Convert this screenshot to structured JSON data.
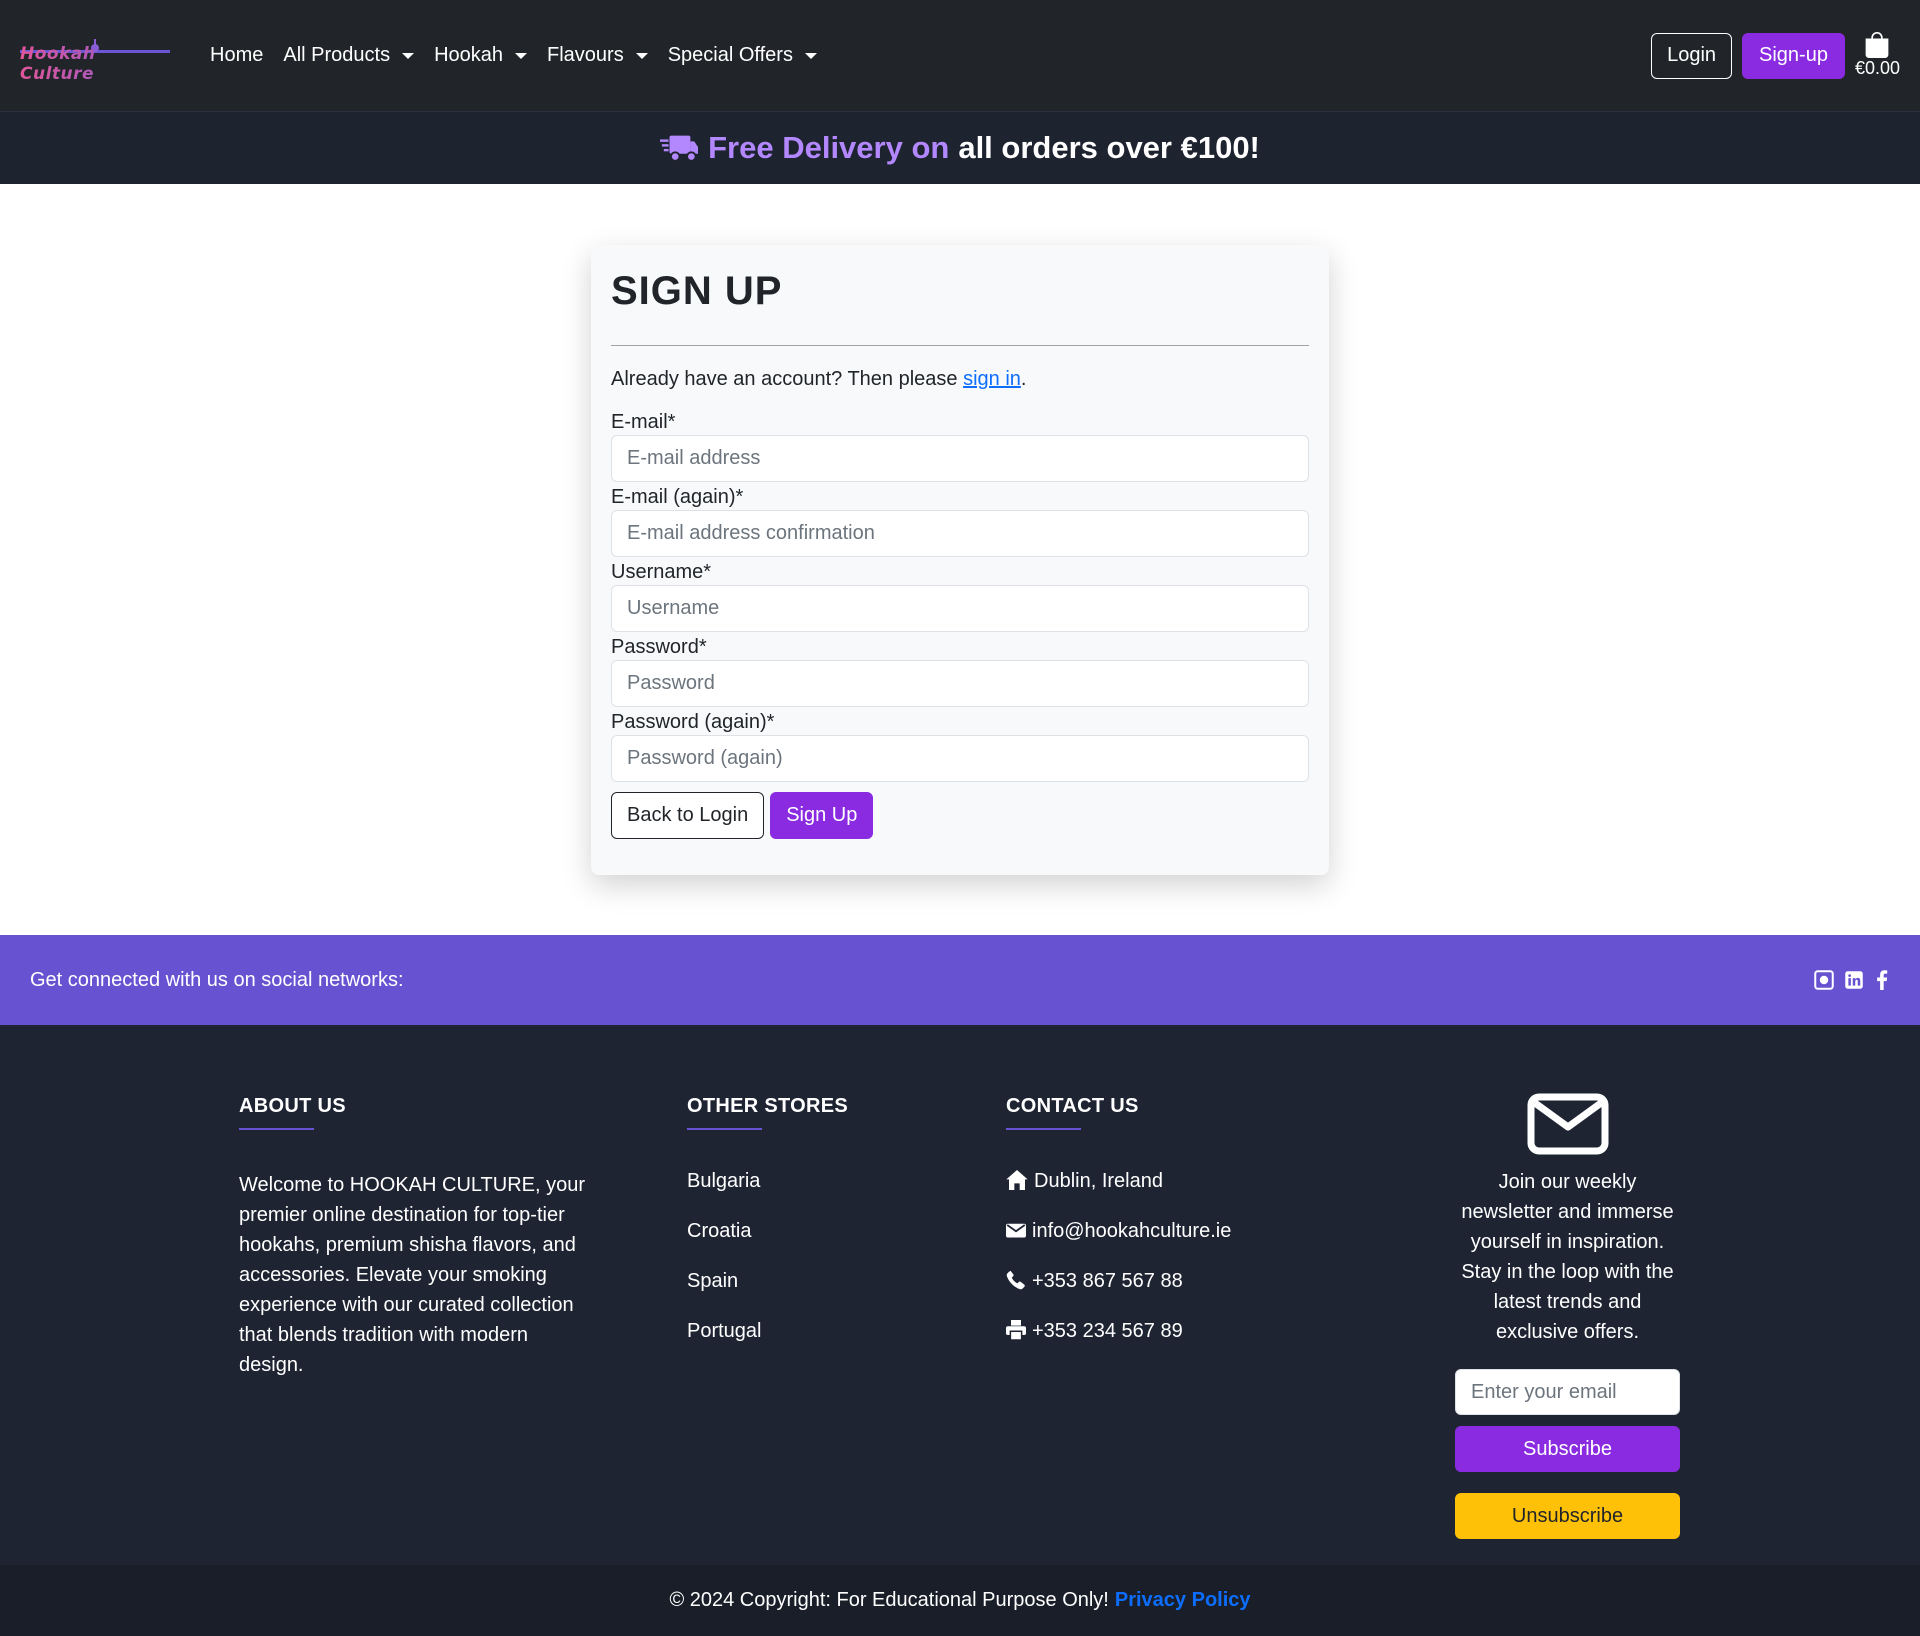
{
  "nav": {
    "logo_text": "Hookah Culture",
    "links": [
      {
        "label": "Home",
        "dropdown": false
      },
      {
        "label": "All Products",
        "dropdown": true
      },
      {
        "label": "Hookah",
        "dropdown": true
      },
      {
        "label": "Flavours",
        "dropdown": true
      },
      {
        "label": "Special Offers",
        "dropdown": true
      }
    ],
    "login_label": "Login",
    "signup_label": "Sign-up",
    "cart_total": "€0.00"
  },
  "banner": {
    "accent_text": "Free Delivery on",
    "rest_text": "all orders over €100!",
    "icon": "truck-icon"
  },
  "signup": {
    "title": "SIGN UP",
    "intro_prefix": "Already have an account? Then please",
    "intro_link": "sign in",
    "intro_suffix": ".",
    "fields": [
      {
        "label": "E-mail*",
        "placeholder": "E-mail address"
      },
      {
        "label": "E-mail (again)*",
        "placeholder": "E-mail address confirmation"
      },
      {
        "label": "Username*",
        "placeholder": "Username"
      },
      {
        "label": "Password*",
        "placeholder": "Password"
      },
      {
        "label": "Password (again)*",
        "placeholder": "Password (again)"
      }
    ],
    "back_label": "Back to Login",
    "submit_label": "Sign Up"
  },
  "social": {
    "text": "Get connected with us on social networks:",
    "icons": [
      "github-icon",
      "linkedin-icon",
      "facebook-icon"
    ]
  },
  "footer": {
    "about": {
      "heading": "ABOUT US",
      "text": "Welcome to HOOKAH CULTURE, your premier online destination for top-tier hookahs, premium shisha flavors, and accessories. Elevate your smoking experience with our curated collection that blends tradition with modern design."
    },
    "stores": {
      "heading": "OTHER STORES",
      "items": [
        "Bulgaria",
        "Croatia",
        "Spain",
        "Portugal"
      ]
    },
    "contact": {
      "heading": "CONTACT US",
      "items": [
        {
          "icon": "home-icon",
          "text": "Dublin, Ireland"
        },
        {
          "icon": "envelope-icon",
          "text": "info@hookahculture.ie"
        },
        {
          "icon": "phone-icon",
          "text": "+353 867 567 88"
        },
        {
          "icon": "printer-icon",
          "text": "+353 234 567 89"
        }
      ]
    },
    "newsletter": {
      "icon": "envelope-large-icon",
      "text": "Join our weekly newsletter and immerse yourself in inspiration. Stay in the loop with the latest trends and exclusive offers.",
      "placeholder": "Enter your email",
      "subscribe_label": "Subscribe",
      "unsubscribe_label": "Unsubscribe"
    }
  },
  "copyright": {
    "text": "© 2024 Copyright: For Educational Purpose Only!",
    "link": "Privacy Policy"
  },
  "colors": {
    "navbar_bg": "#212529",
    "accent_purple": "#8a2be2",
    "social_bar": "#6753d1",
    "footer_bg": "#1f2433",
    "unsubscribe": "#ffc107",
    "link_blue": "#0d6efd",
    "banner_accent": "#b388ff"
  }
}
